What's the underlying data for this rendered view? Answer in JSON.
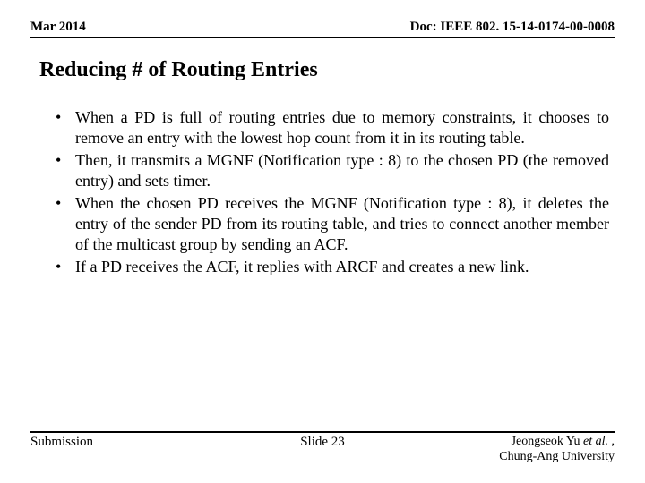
{
  "header": {
    "date": "Mar 2014",
    "doc": "Doc: IEEE 802. 15-14-0174-00-0008"
  },
  "title": "Reducing # of Routing Entries",
  "bullets": [
    "When a PD is full of routing entries due to memory constraints, it chooses to remove an entry with the lowest hop count from it in its routing table.",
    "Then, it transmits a MGNF (Notification type : 8) to the chosen PD (the removed entry) and sets timer.",
    "When the chosen PD receives the MGNF (Notification type : 8), it deletes the entry of the sender PD from its routing table, and tries to connect another member of the multicast group by sending an ACF.",
    "If a PD receives the ACF, it replies with ARCF and creates a new link."
  ],
  "footer": {
    "left": "Submission",
    "center": "Slide 23",
    "author_prefix": "Jeongseok Yu ",
    "author_italic": "et al.",
    "author_suffix": " ,",
    "affiliation": "Chung-Ang University"
  }
}
